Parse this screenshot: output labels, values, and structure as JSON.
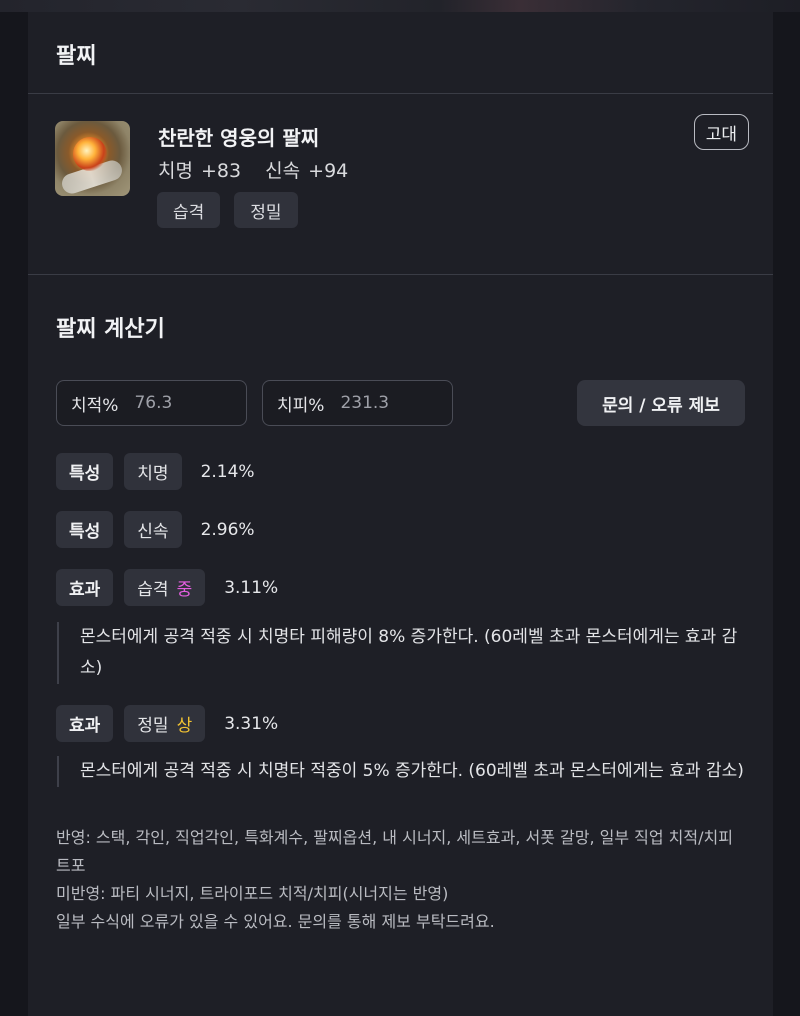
{
  "header": {
    "title": "팔찌"
  },
  "item": {
    "name": "찬란한 영웅의 팔찌",
    "stats": [
      "치명 +83",
      "신속 +94"
    ],
    "tags": [
      "습격",
      "정밀"
    ],
    "grade": "고대",
    "icon": "bracelet-icon"
  },
  "calculator": {
    "title": "팔찌 계산기",
    "crit_rate": {
      "label": "치적%",
      "value": "76.3"
    },
    "crit_damage": {
      "label": "치피%",
      "value": "231.3"
    },
    "report_button": "문의 / 오류 제보",
    "rows": [
      {
        "kind": "특성",
        "name": "치명",
        "level": "",
        "value": "2.14%"
      },
      {
        "kind": "특성",
        "name": "신속",
        "level": "",
        "value": "2.96%"
      },
      {
        "kind": "효과",
        "name": "습격",
        "level": "중",
        "value": "3.11%",
        "description": "몬스터에게 공격 적중 시 치명타 피해량이 8% 증가한다. (60레벨 초과 몬스터에게는 효과 감소)"
      },
      {
        "kind": "효과",
        "name": "정밀",
        "level": "상",
        "value": "3.31%",
        "description": "몬스터에게 공격 적중 시 치명타 적중이 5% 증가한다. (60레벨 초과 몬스터에게는 효과 감소)"
      }
    ],
    "notes": {
      "applied": "반영: 스택, 각인, 직업각인, 특화계수, 팔찌옵션, 내 시너지, 세트효과, 서폿 갈망, 일부 직업 치적/치피 트포",
      "not_applied": "미반영: 파티 시너지, 트라이포드 치적/치피(시너지는 반영)",
      "disclaimer": "일부 수식에 오류가 있을 수 있어요. 문의를 통해 제보 부탁드려요."
    }
  },
  "colors": {
    "level_mid": "#e45ee0",
    "level_high": "#f1c232",
    "background": "#1e1f26"
  }
}
